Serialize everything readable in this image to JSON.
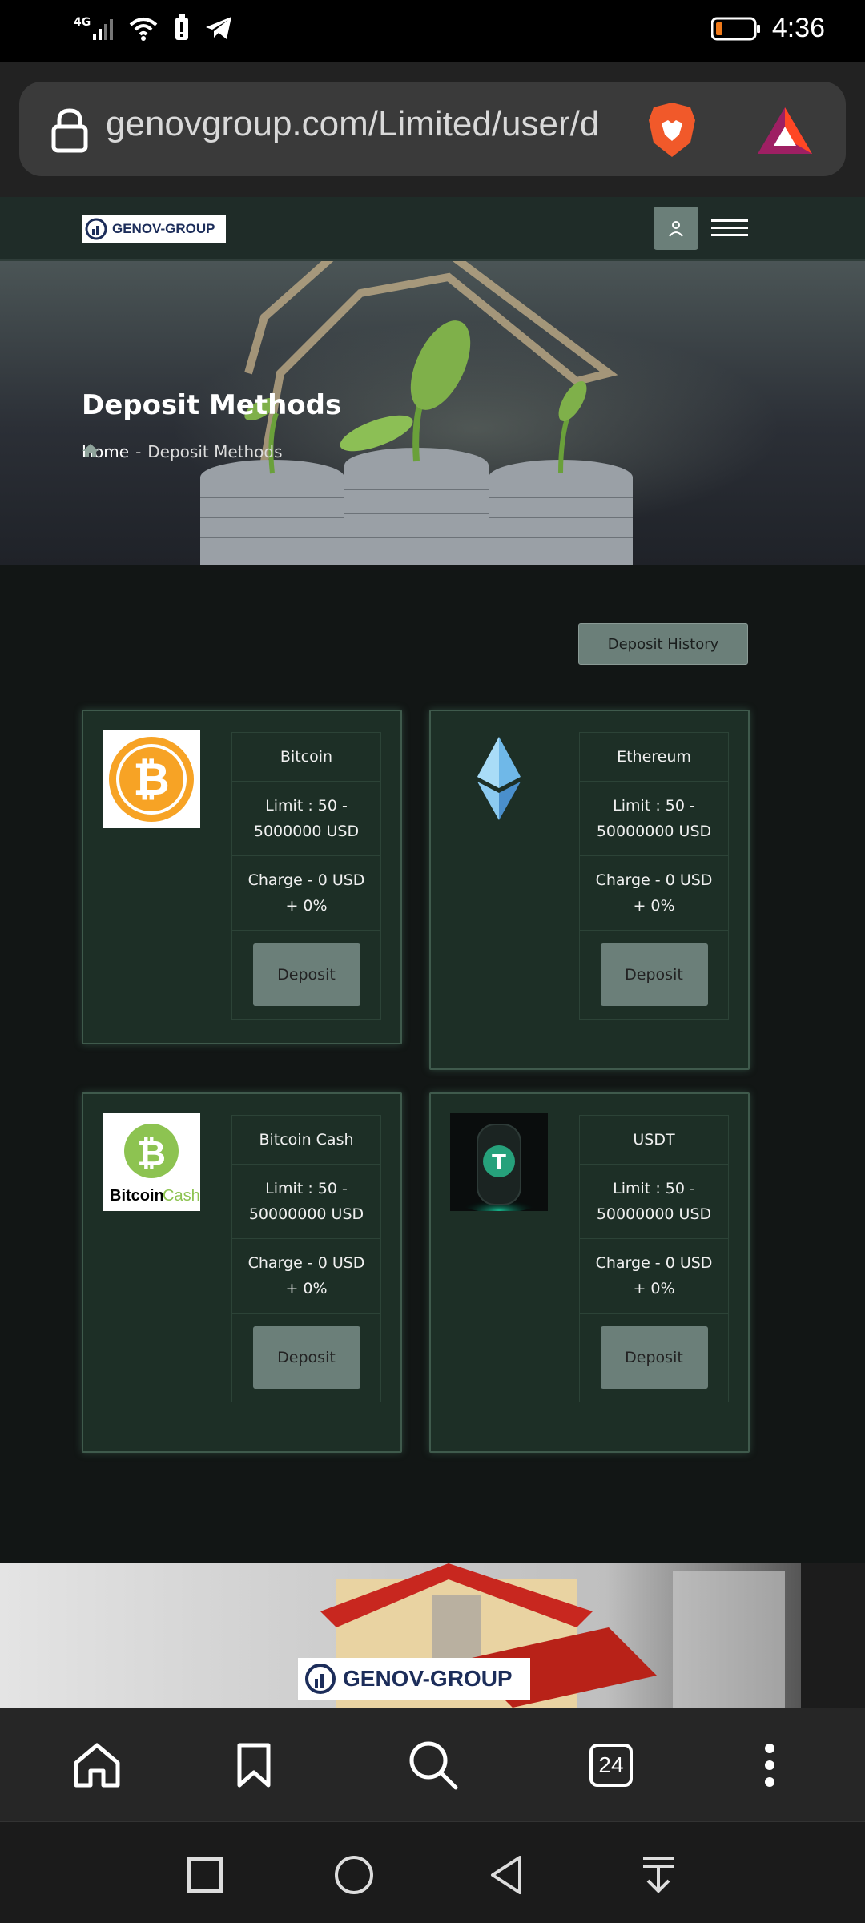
{
  "status_bar": {
    "time": "4:36",
    "network": "4G"
  },
  "browser": {
    "url": "genovgroup.com/Limited/user/d",
    "tab_count": "24"
  },
  "site": {
    "brand": "GENOV-GROUP"
  },
  "hero": {
    "title": "Deposit Methods",
    "breadcrumb_home": "Home",
    "breadcrumb_sep": "-",
    "breadcrumb_current": "Deposit Methods"
  },
  "deposit_history_label": "Deposit History",
  "methods": [
    {
      "name": "Bitcoin",
      "limit": "Limit : 50 - 5000000 USD",
      "charge": "Charge - 0 USD + 0%",
      "button": "Deposit",
      "icon": "bitcoin-icon"
    },
    {
      "name": "Ethereum",
      "limit": "Limit : 50 - 50000000 USD",
      "charge": "Charge - 0 USD + 0%",
      "button": "Deposit",
      "icon": "ethereum-icon"
    },
    {
      "name": "Bitcoin Cash",
      "limit": "Limit : 50 - 50000000 USD",
      "charge": "Charge - 0 USD + 0%",
      "button": "Deposit",
      "icon": "bitcoin-cash-icon",
      "logo_text_a": "Bitcoin",
      "logo_text_b": "Cash"
    },
    {
      "name": "USDT",
      "limit": "Limit : 50 - 50000000 USD",
      "charge": "Charge - 0 USD + 0%",
      "button": "Deposit",
      "icon": "usdt-icon"
    }
  ],
  "colors": {
    "card_bg": "#1d2f26",
    "button_bg": "#6b7f79",
    "page_bg": "#121615"
  }
}
